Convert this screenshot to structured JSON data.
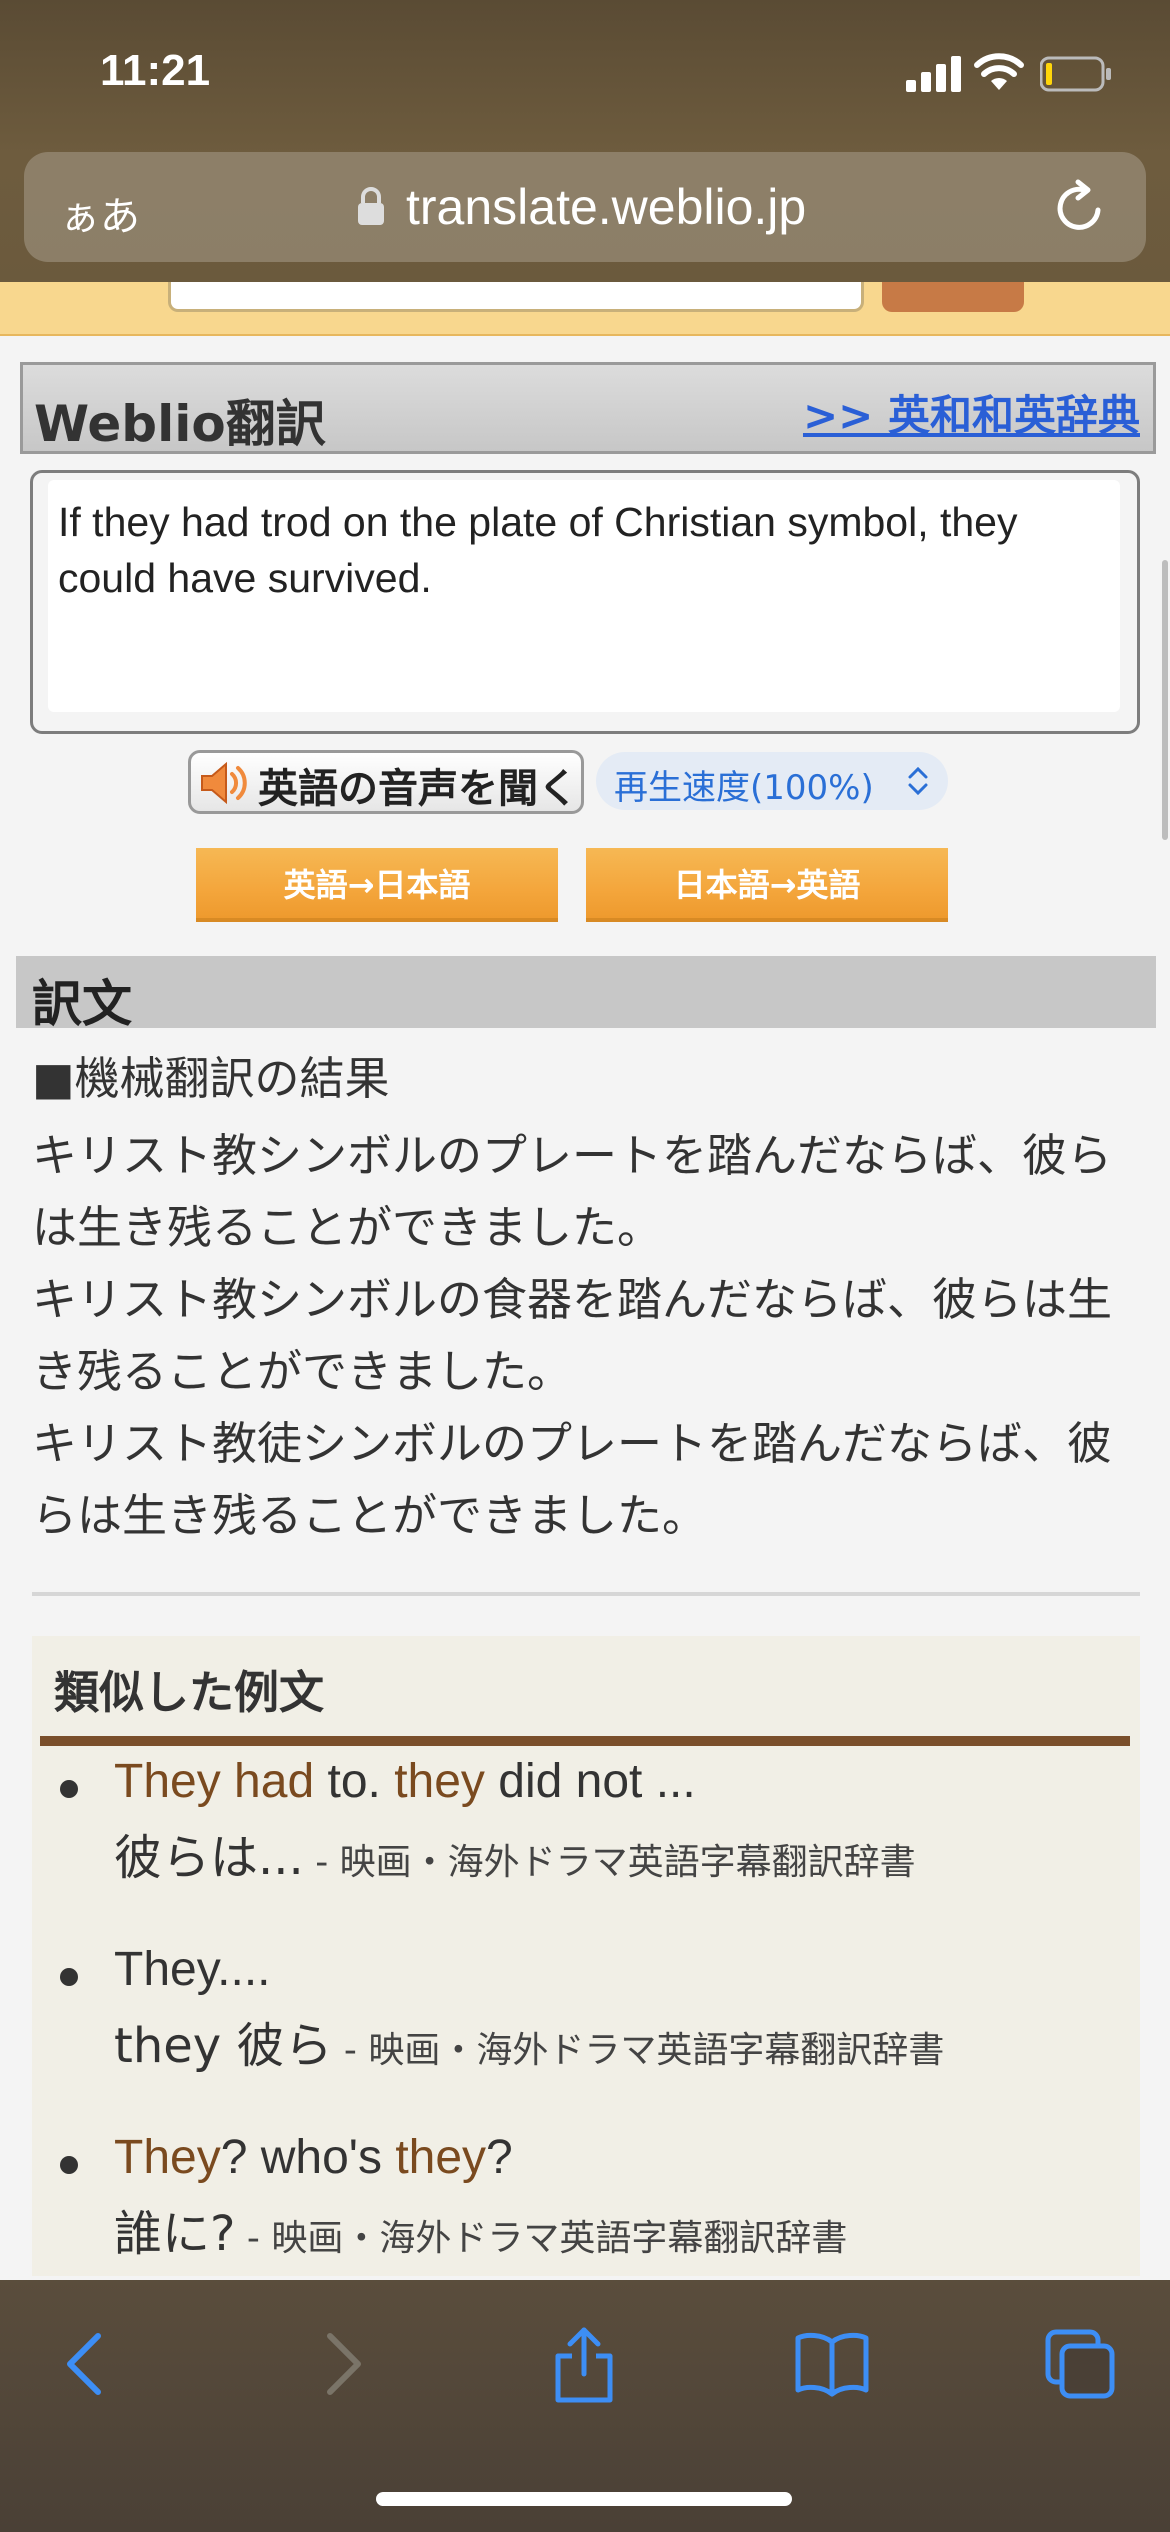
{
  "status_bar": {
    "time": "11:21"
  },
  "browser": {
    "aa_label": "ぁあ",
    "url": "translate.weblio.jp"
  },
  "weblio": {
    "title": "Weblio翻訳",
    "dict_link": ">> 英和和英辞典",
    "input_text": "If they had trod on the plate of Christian symbol, they could have survived.",
    "audio_label": "英語の音声を聞く",
    "speed_label": "再生速度(100%)",
    "btn_en_ja": "英語→日本語",
    "btn_ja_en": "日本語→英語"
  },
  "result": {
    "header": "訳文",
    "subtitle": "■機械翻訳の結果",
    "lines": [
      "キリスト教シンボルのプレートを踏んだならば、彼らは生き残ることができました。",
      "キリスト教シンボルの食器を踏んだならば、彼らは生き残ることができました。",
      "キリスト教徒シンボルのプレートを踏んだならば、彼らは生き残ることができました。"
    ]
  },
  "examples": {
    "title": "類似した例文",
    "items": [
      {
        "en_parts": [
          {
            "t": "They had",
            "hl": true
          },
          {
            "t": " to. ",
            "hl": false
          },
          {
            "t": "they",
            "hl": true
          },
          {
            "t": " did not ...",
            "hl": false
          }
        ],
        "ja": "彼らは...",
        "source": " - 映画・海外ドラマ英語字幕翻訳辞書"
      },
      {
        "en_parts": [
          {
            "t": "They....",
            "hl": false
          }
        ],
        "ja": "they 彼ら",
        "source": " - 映画・海外ドラマ英語字幕翻訳辞書"
      },
      {
        "en_parts": [
          {
            "t": "They",
            "hl": true
          },
          {
            "t": "? who's ",
            "hl": false
          },
          {
            "t": "they",
            "hl": true
          },
          {
            "t": "?",
            "hl": false
          }
        ],
        "ja": "誰に?",
        "source": " - 映画・海外ドラマ英語字幕翻訳辞書"
      }
    ]
  },
  "colors": {
    "accent_orange": "#f4a63c",
    "link_blue": "#2a5fd6",
    "highlight_brown": "#7a4a1f",
    "toolbar_icon": "#3d8ef5"
  },
  "toolbar": {
    "icons": [
      "back-icon",
      "forward-icon",
      "share-icon",
      "bookmarks-icon",
      "tabs-icon"
    ]
  }
}
